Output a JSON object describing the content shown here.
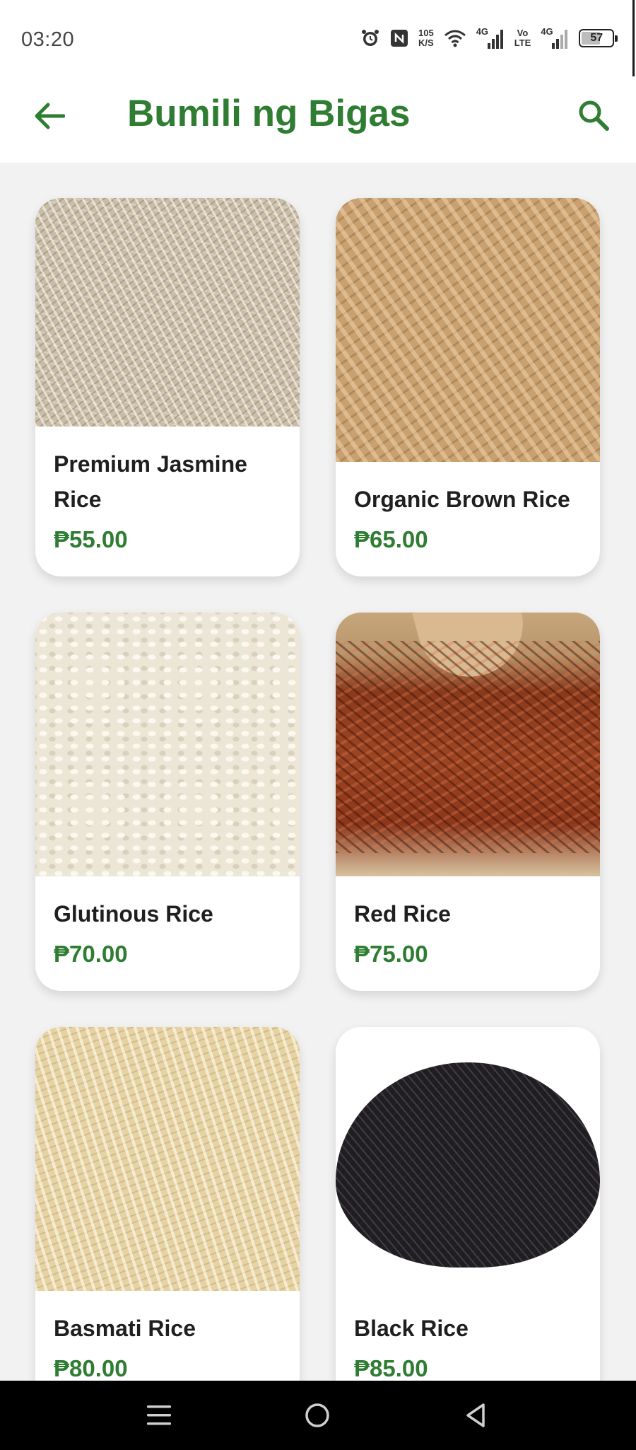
{
  "status_bar": {
    "time": "03:20",
    "net_speed_value": "105",
    "net_speed_unit": "K/S",
    "network_1": "4G",
    "volte_top": "Vo",
    "volte_bottom": "LTE",
    "network_2": "4G",
    "battery": "57",
    "icons": [
      "alarm-icon",
      "nfc-icon",
      "wifi-icon",
      "signal-icon",
      "signal-icon",
      "battery-icon"
    ]
  },
  "app_bar": {
    "title": "Bumili ng Bigas",
    "back_icon": "arrow-left-icon",
    "search_icon": "search-icon"
  },
  "products": [
    {
      "name": "Premium Jasmine Rice",
      "price": "₱55.00"
    },
    {
      "name": "Organic Brown Rice",
      "price": "₱65.00"
    },
    {
      "name": "Glutinous Rice",
      "price": "₱70.00"
    },
    {
      "name": "Red Rice",
      "price": "₱75.00"
    },
    {
      "name": "Basmati Rice",
      "price": "₱80.00"
    },
    {
      "name": "Black Rice",
      "price": "₱85.00"
    }
  ],
  "colors": {
    "accent": "#2e7d32",
    "background": "#f2f2f2",
    "card": "#ffffff",
    "nav_bar": "#000000"
  },
  "nav_bar": {
    "icons": [
      "menu-icon",
      "home-circle-icon",
      "back-triangle-icon"
    ]
  }
}
